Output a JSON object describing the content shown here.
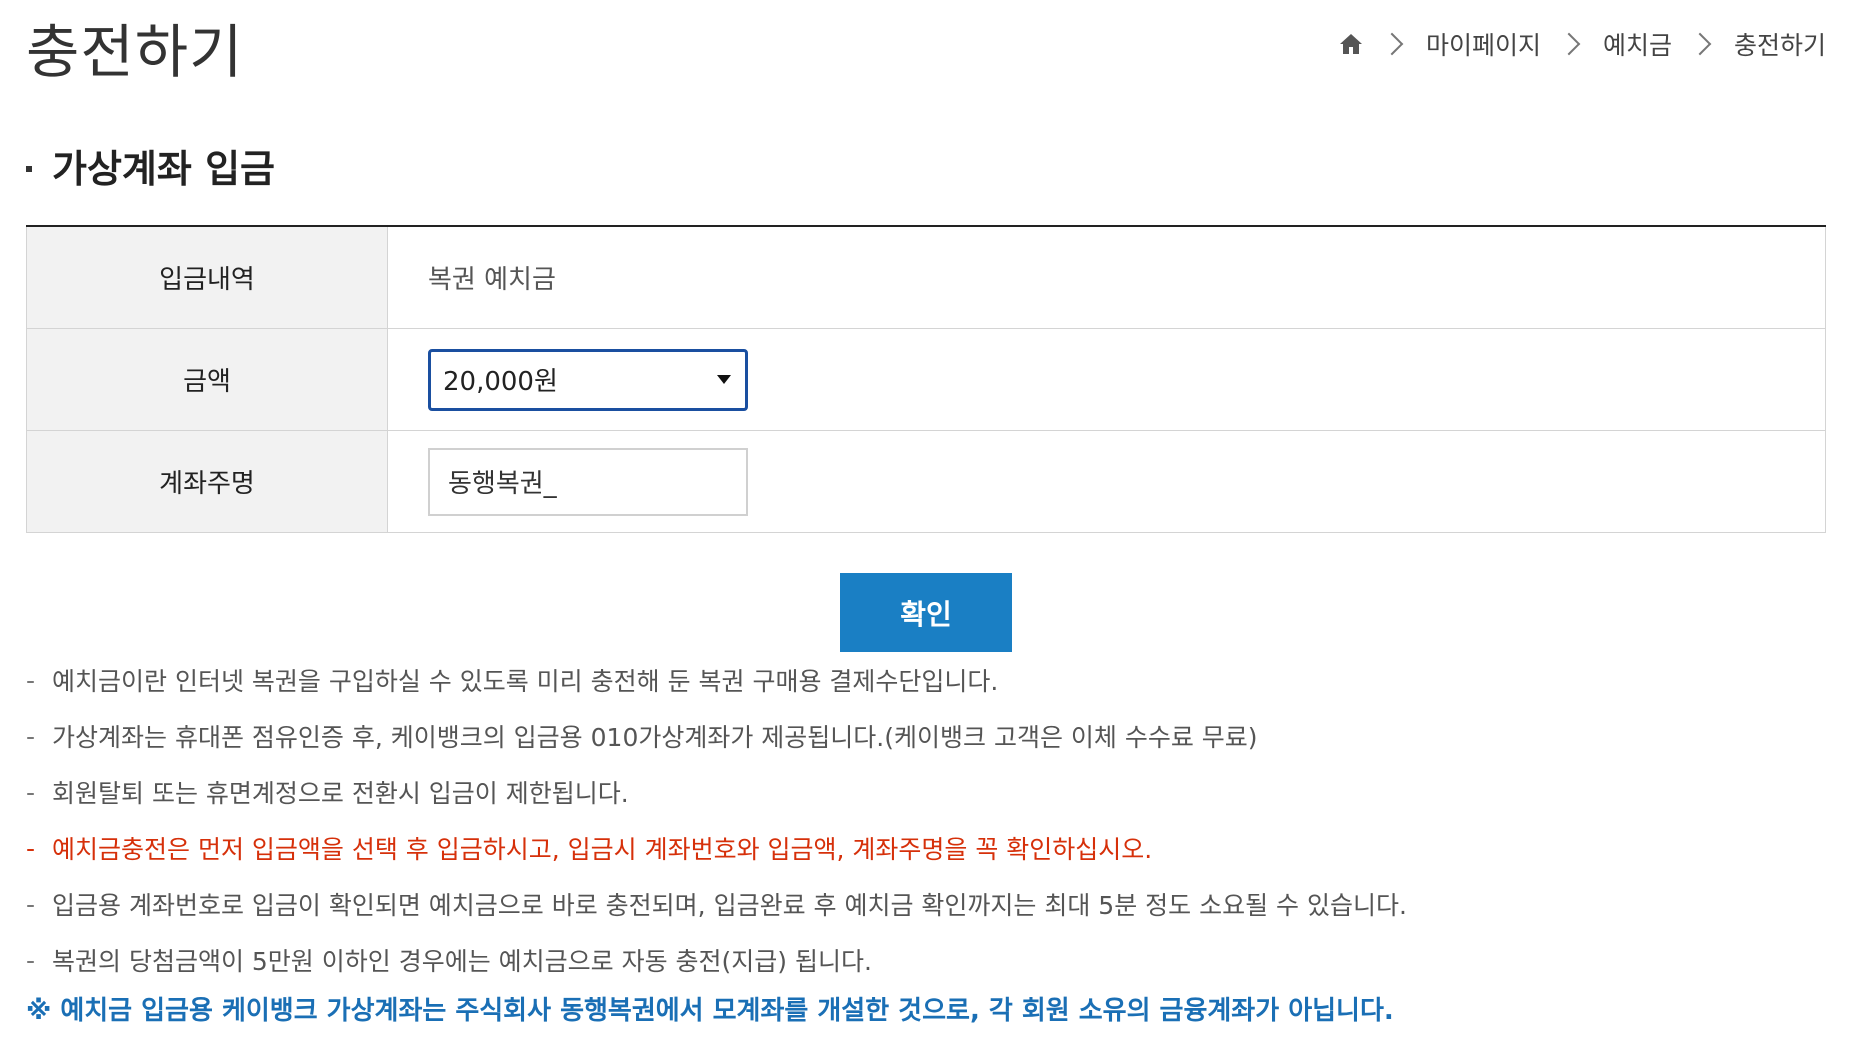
{
  "page": {
    "title": "충전하기"
  },
  "breadcrumb": {
    "home_icon": "home-icon",
    "items": [
      "마이페이지",
      "예치금",
      "충전하기"
    ]
  },
  "section": {
    "heading": "가상계좌 입금"
  },
  "form": {
    "rows": [
      {
        "label": "입금내역",
        "value": "복권 예치금"
      },
      {
        "label": "금액",
        "selected": "20,000원"
      },
      {
        "label": "계좌주명",
        "input_value": "동행복권_"
      }
    ]
  },
  "actions": {
    "confirm_label": "확인"
  },
  "notes": [
    "예치금이란 인터넷 복권을 구입하실 수 있도록 미리 충전해 둔 복권 구매용 결제수단입니다.",
    "가상계좌는 휴대폰 점유인증 후, 케이뱅크의 입금용 010가상계좌가 제공됩니다.(케이뱅크 고객은 이체 수수료 무료)",
    "회원탈퇴 또는 휴면계정으로 전환시 입금이 제한됩니다.",
    "예치금충전은 먼저 입금액을 선택 후 입금하시고, 입금시 계좌번호와 입금액, 계좌주명을 꼭 확인하십시오.",
    "입금용 계좌번호로 입금이 확인되면 예치금으로 바로 충전되며, 입금완료 후 예치금 확인까지는 최대 5분 정도 소요될 수 있습니다.",
    "복권의 당첨금액이 5만원 이하인 경우에는 예치금으로 자동 충전(지급) 됩니다."
  ],
  "note_dash": "-",
  "footer_notice": "※ 예치금 입금용 케이뱅크 가상계좌는 주식회사 동행복권에서 모계좌를 개설한 것으로, 각 회원 소유의 금융계좌가 아닙니다.",
  "colors": {
    "accent_button": "#1a7fc4",
    "warning_text": "#d6300a",
    "notice_text": "#1a6fb5",
    "select_border": "#1a4fa0"
  }
}
